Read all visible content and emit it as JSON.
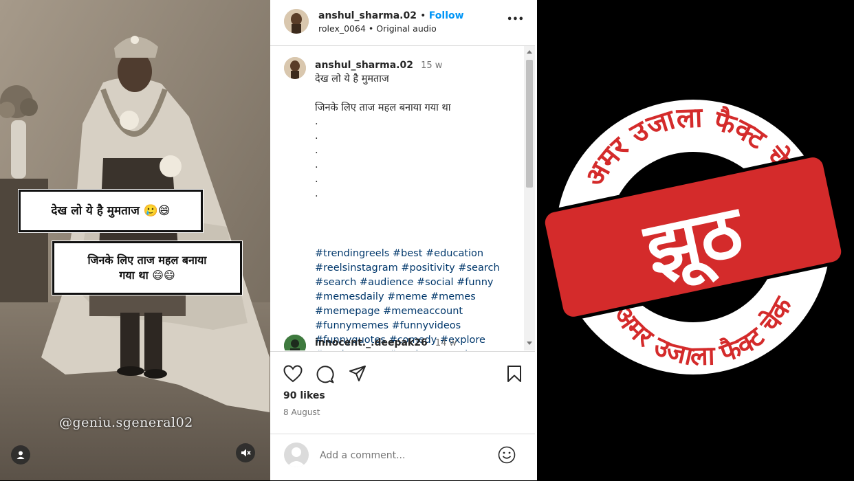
{
  "post": {
    "username": "anshul_sharma.02",
    "follow_label": "Follow",
    "audio_author": "rolex_0064",
    "audio_label": "Original audio",
    "more_label": "•••"
  },
  "media": {
    "caption_line1": "देख लो ये है मुमताज 🥲😄",
    "caption_line2a": "जिनके लिए ताज महल बनाया",
    "caption_line2b": "गया था 😄😄",
    "watermark": "@geniu.sgeneral02"
  },
  "caption": {
    "username": "anshul_sharma.02",
    "time": "15 w",
    "line1": "देख लो ये है मुमताज",
    "line2": "जिनके लिए ताज महल बनाया गया था",
    "dots": [
      ".",
      ".",
      ".",
      ".",
      ".",
      "."
    ],
    "hashtags": "#trendingreels #best #education #reelsinstagram #positivity #search #search #audience #social #funny #memesdaily #meme #memes #memepage #memeaccount #funnymemes #funnyvideos #funnyquotes #comedy #explore #explorepage #geniusgenaral"
  },
  "comment": {
    "username": "innocent._.deepak26",
    "time": "14 w"
  },
  "engagement": {
    "likes": "90 likes",
    "date": "8 August",
    "comment_placeholder": "Add a comment..."
  },
  "stamp": {
    "arc_text": "अमर उजाला फैक्ट चेक",
    "verdict": "झूठ",
    "colors": {
      "red": "#d42b2b",
      "white": "#ffffff",
      "black": "#000000"
    }
  }
}
